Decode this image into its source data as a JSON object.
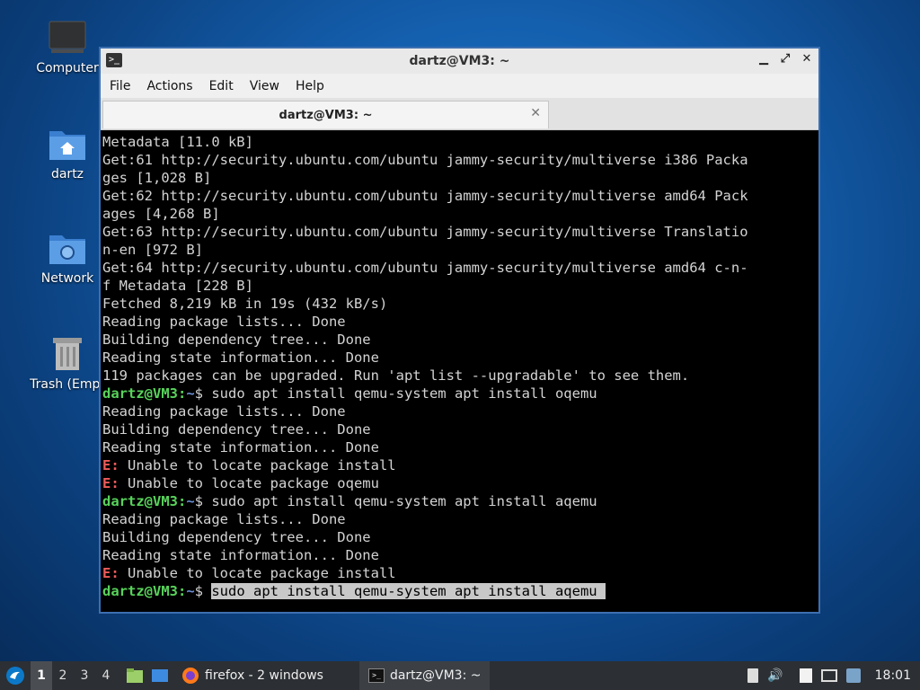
{
  "desktop": {
    "icons": [
      {
        "label": "Computer"
      },
      {
        "label": "dartz"
      },
      {
        "label": "Network"
      },
      {
        "label": "Trash (Empt"
      }
    ]
  },
  "window": {
    "title": "dartz@VM3: ~",
    "controls": {
      "minimize": "▁",
      "maximize": "⤢",
      "close": "✕"
    },
    "menu": [
      "File",
      "Actions",
      "Edit",
      "View",
      "Help"
    ],
    "tab": {
      "label": "dartz@VM3: ~",
      "close": "✕"
    }
  },
  "terminal": {
    "prompt_user": "dartz@VM3:",
    "prompt_path": "~",
    "prompt_sym": "$ ",
    "lines": [
      "Metadata [11.0 kB]",
      "Get:61 http://security.ubuntu.com/ubuntu jammy-security/multiverse i386 Packa",
      "ges [1,028 B]",
      "Get:62 http://security.ubuntu.com/ubuntu jammy-security/multiverse amd64 Pack",
      "ages [4,268 B]",
      "Get:63 http://security.ubuntu.com/ubuntu jammy-security/multiverse Translatio",
      "n-en [972 B]",
      "Get:64 http://security.ubuntu.com/ubuntu jammy-security/multiverse amd64 c-n-",
      "f Metadata [228 B]",
      "Fetched 8,219 kB in 19s (432 kB/s)",
      "Reading package lists... Done",
      "Building dependency tree... Done",
      "Reading state information... Done",
      "119 packages can be upgraded. Run 'apt list --upgradable' to see them."
    ],
    "cmd1": "sudo apt install qemu-system apt install oqemu",
    "out1": [
      "Reading package lists... Done",
      "Building dependency tree... Done",
      "Reading state information... Done"
    ],
    "err_prefix": "E:",
    "err1a": " Unable to locate package install",
    "err1b": " Unable to locate package oqemu",
    "cmd2": "sudo apt install qemu-system apt install aqemu",
    "out2": [
      "Reading package lists... Done",
      "Building dependency tree... Done",
      "Reading state information... Done"
    ],
    "err2a": " Unable to locate package install",
    "cmd3": "sudo apt install qemu-system apt install aqemu "
  },
  "taskbar": {
    "workspaces": [
      "1",
      "2",
      "3",
      "4"
    ],
    "tasks": [
      {
        "label": "firefox - 2 windows"
      },
      {
        "label": "dartz@VM3: ~"
      }
    ],
    "clock": "18:01"
  }
}
